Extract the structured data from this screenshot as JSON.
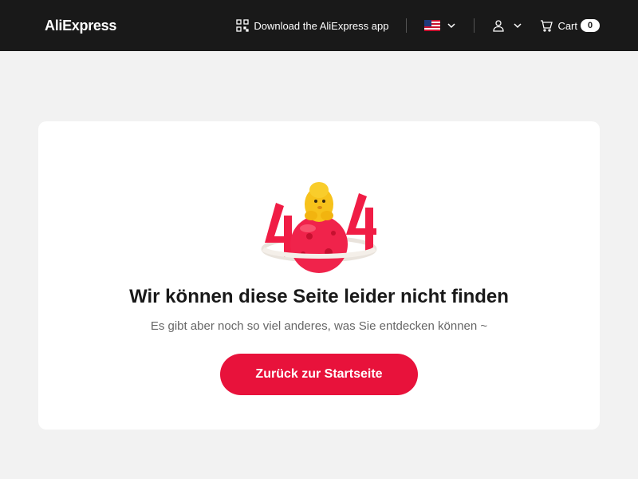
{
  "header": {
    "logo_text": "AliExpress",
    "download_app_label": "Download the AliExpress app",
    "cart_label": "Cart",
    "cart_count": "0",
    "icons": [
      "qr-code-icon",
      "us-flag-icon",
      "chevron-down-icon",
      "user-icon",
      "cart-icon"
    ]
  },
  "error_card": {
    "illustration": "404-mascot-illustration",
    "title": "Wir können diese Seite leider nicht finden",
    "subtitle": "Es gibt aber noch so viel anderes, was Sie entdecken können ~",
    "button_label": "Zurück zur Startseite"
  },
  "colors": {
    "header_bg": "#191919",
    "page_bg": "#f2f2f2",
    "accent": "#e8123b",
    "logo_accent": "#fd384f"
  }
}
